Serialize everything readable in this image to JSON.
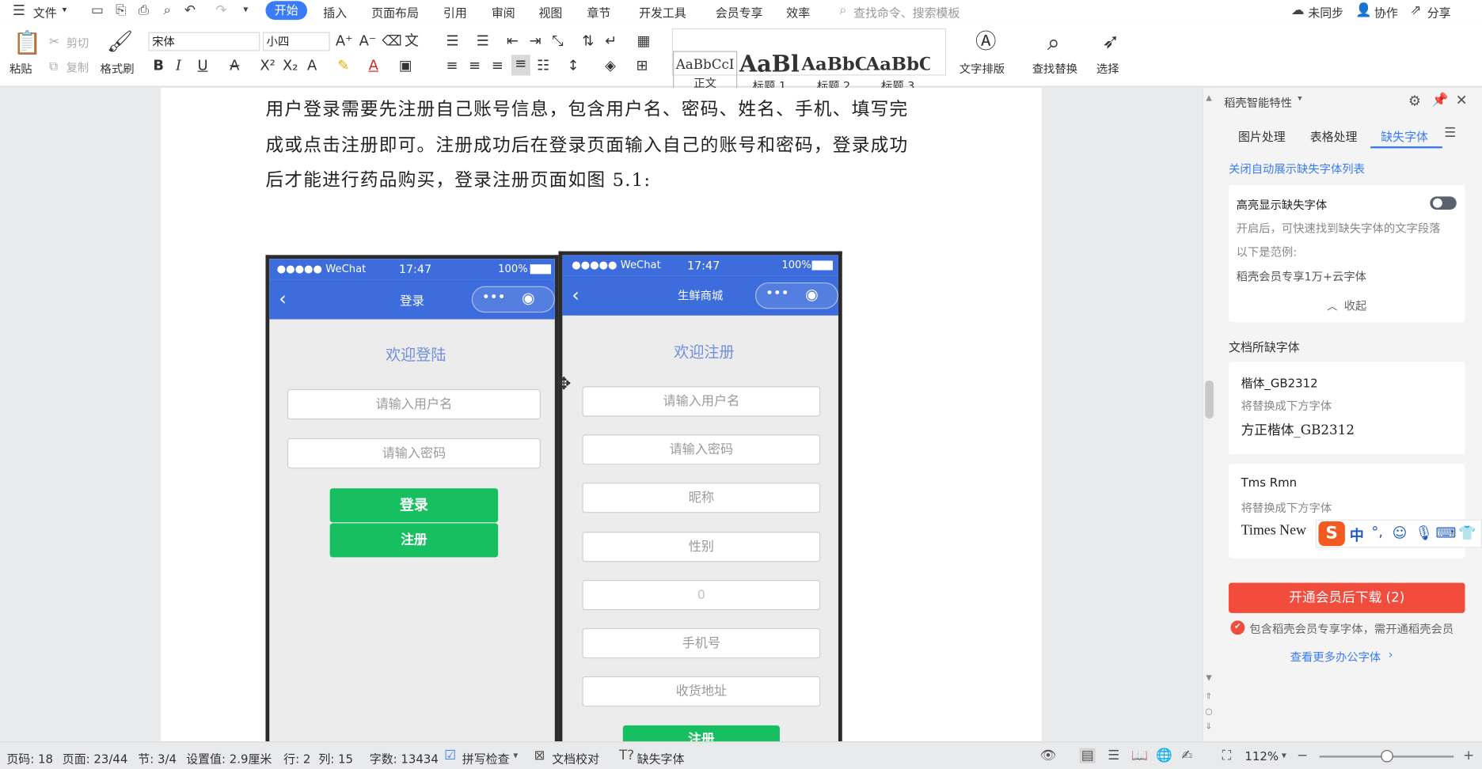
{
  "menubar": {
    "file": "文件",
    "tabs": [
      "开始",
      "插入",
      "页面布局",
      "引用",
      "审阅",
      "视图",
      "章节",
      "开发工具",
      "会员专享",
      "效率"
    ],
    "search_placeholder": "查找命令、搜索模板",
    "sync": "未同步",
    "collab": "协作",
    "share": "分享"
  },
  "ribbon": {
    "paste": "粘贴",
    "cut": "剪切",
    "copy": "复制",
    "format_painter": "格式刷",
    "font_name": "宋体",
    "font_size": "小四",
    "styles": [
      {
        "preview": "AaBbCcI",
        "label": "正文"
      },
      {
        "preview": "AaBl",
        "label": "标题 1"
      },
      {
        "preview": "AaBbC",
        "label": "标题 2"
      },
      {
        "preview": "AaBbC",
        "label": "标题 3"
      }
    ],
    "text_layout": "文字排版",
    "find_replace": "查找替换",
    "select": "选择"
  },
  "document": {
    "lines": [
      "用户登录需要先注册自己账号信息，包含用户名、密码、姓名、手机、填写完",
      "成或点击注册即可。注册成功后在登录页面输入自己的账号和密码，登录成功",
      "后才能进行药品购买，登录注册页面如图 5.1:"
    ],
    "login_phone": {
      "carrier": "●●●●● WeChat",
      "time": "17:47",
      "battery": "100%",
      "title": "登录",
      "welcome": "欢迎登陆",
      "username_placeholder": "请输入用户名",
      "password_placeholder": "请输入密码",
      "login_button": "登录",
      "register_button": "注册"
    },
    "register_phone": {
      "carrier": "●●●●● WeChat",
      "time": "17:47",
      "battery": "100%",
      "title": "生鲜商城",
      "welcome": "欢迎注册",
      "fields": [
        "请输入用户名",
        "请输入密码",
        "昵称",
        "性别",
        "0",
        "手机号",
        "收货地址"
      ],
      "submit": "注册"
    }
  },
  "panel": {
    "title": "稻壳智能特性",
    "tabs": [
      "图片处理",
      "表格处理",
      "缺失字体"
    ],
    "close_auto": "关闭自动展示缺失字体列表",
    "highlight_title": "高亮显示缺失字体",
    "highlight_desc": "开启后，可快速找到缺失字体的文字段落",
    "example_label": "以下是范例:",
    "example_text": "稻壳会员专享1万+云字体",
    "collapse": "收起",
    "missing_header": "文档所缺字体",
    "fonts": [
      {
        "name": "楷体_GB2312",
        "hint": "将替换成下方字体",
        "replacement": "方正楷体_GB2312"
      },
      {
        "name": "Tms Rmn",
        "hint": "将替换成下方字体",
        "replacement": "Times New"
      }
    ],
    "download_button": "开通会员后下载 (2)",
    "member_note": "包含稻壳会员专享字体，需开通稻壳会员",
    "more_fonts": "查看更多办公字体"
  },
  "ime": {
    "lang": "中"
  },
  "statusbar": {
    "page_num": "页码: 18",
    "pages": "页面: 23/44",
    "section": "节: 3/4",
    "setting": "设置值: 2.9厘米",
    "row": "行: 2",
    "col": "列: 15",
    "words": "字数: 13434",
    "spell": "拼写检查",
    "proof": "文档校对",
    "missing_font": "缺失字体",
    "zoom": "112%"
  },
  "colors": {
    "accent": "#3a7bf7",
    "wechat_blue": "#3d6ddc",
    "green": "#16c060",
    "download_red": "#f24c3d"
  }
}
